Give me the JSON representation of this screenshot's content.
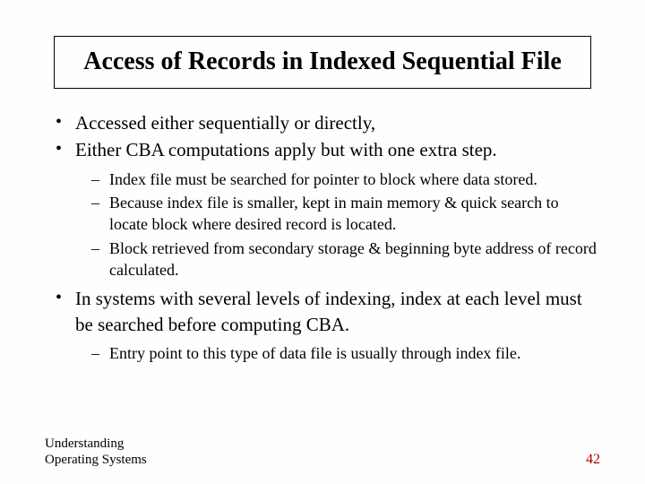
{
  "title": "Access of Records in Indexed Sequential File",
  "bullets": {
    "b0": "Accessed either sequentially or directly,",
    "b1": "Either CBA computations apply but with one extra step.",
    "b1_sub": {
      "s0": "Index file must be searched for pointer to block where data stored.",
      "s1": "Because index file is smaller, kept in main memory & quick search to locate block where desired record is located.",
      "s2": "Block retrieved from secondary storage & beginning byte address of record calculated."
    },
    "b2": "In systems with several levels of indexing, index at each level must be searched before computing CBA.",
    "b2_sub": {
      "s0": "Entry point to this type of data file is usually through index file."
    }
  },
  "footer": {
    "left_line1": "Understanding",
    "left_line2": "Operating Systems",
    "page": "42"
  }
}
